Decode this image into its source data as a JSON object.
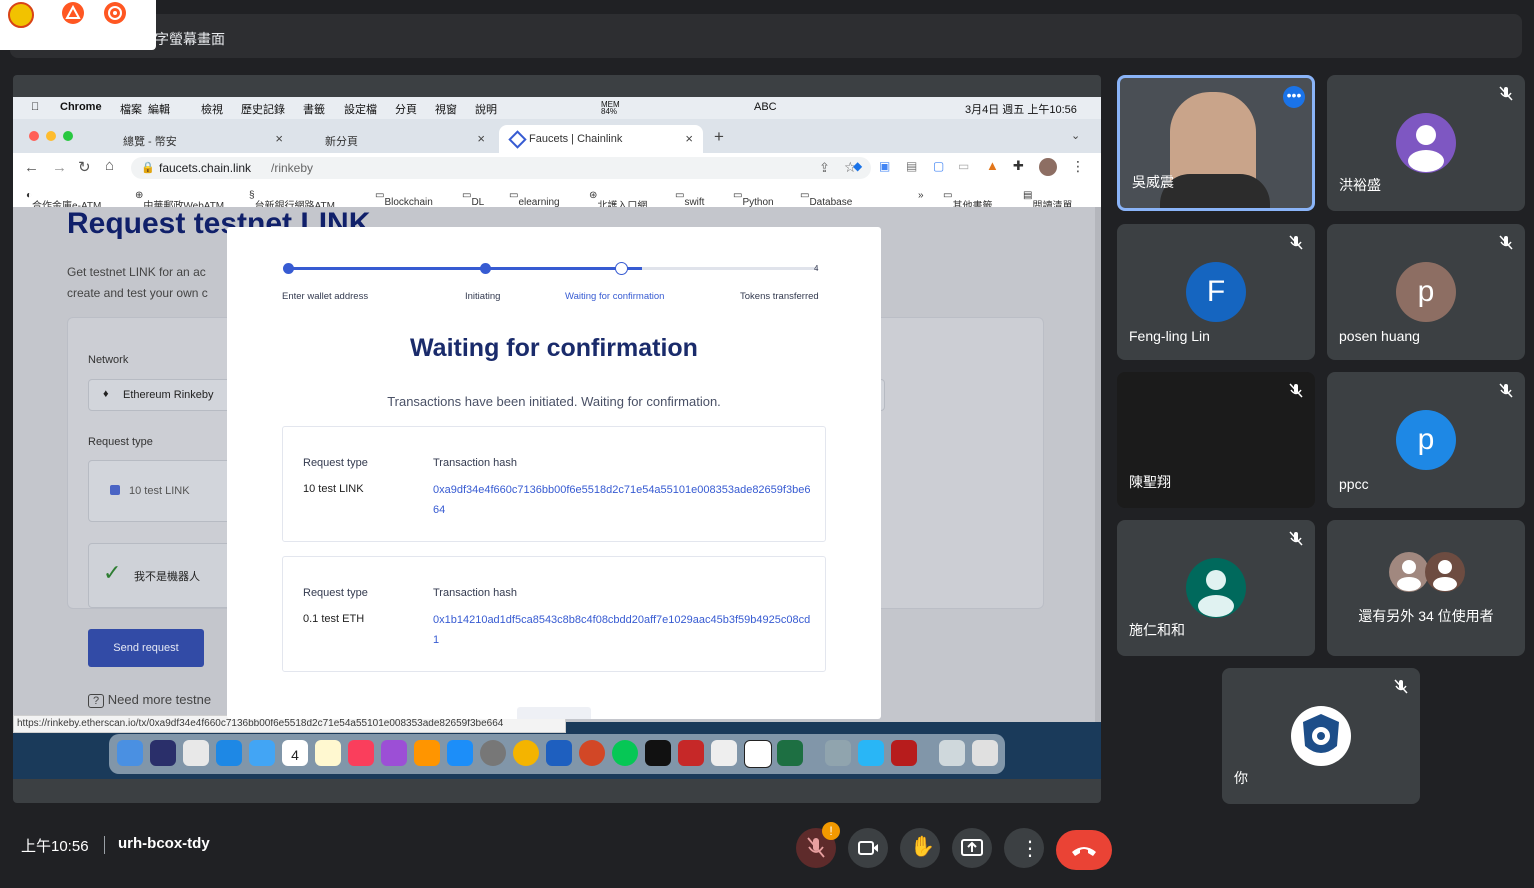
{
  "banner": {
    "title": "字螢幕畫面"
  },
  "mac_menu": {
    "apple": "",
    "app": "Chrome",
    "items": [
      "檔案",
      "編輯",
      "檢視",
      "歷史記錄",
      "書籤",
      "設定檔",
      "分頁",
      "視窗",
      "說明"
    ],
    "mem": "MEM 84%",
    "input": "ABC",
    "datetime": "3月4日 週五 上午10:56"
  },
  "tabs": [
    {
      "label": "總覽 - 幣安"
    },
    {
      "label": "新分頁"
    },
    {
      "label": "Faucets | Chainlink"
    }
  ],
  "omnibox": {
    "host": "faucets.chain.link",
    "path": "/rinkeby"
  },
  "bookmarks": [
    "合作金庫e-ATM",
    "中華郵政WebATM",
    "台新銀行網路ATM...",
    "Blockchain",
    "DL",
    "elearning",
    "北護入口網",
    "swift",
    "Python",
    "Database",
    "»",
    "其他書籤",
    "閱讀清單"
  ],
  "page": {
    "title": "Request testnet LINK",
    "intro_1": "Get testnet LINK for an ac",
    "intro_2": "create and test your own c",
    "network_label": "Network",
    "network_value": "Ethereum Rinkeby",
    "request_type_label": "Request type",
    "request_option": "10 test LINK",
    "captcha_label": "我不是機器人",
    "send_button": "Send request",
    "need_more": "Need more testne"
  },
  "modal": {
    "steps": [
      {
        "label": "Enter wallet address",
        "state": "done"
      },
      {
        "label": "Initiating",
        "state": "done"
      },
      {
        "label": "Waiting for confirmation",
        "state": "current"
      },
      {
        "label": "Tokens transferred",
        "state": "pending",
        "number": "4"
      }
    ],
    "progress_fraction": 0.667,
    "title": "Waiting for confirmation",
    "subtitle": "Transactions have been initiated. Waiting for confirmation.",
    "transactions": [
      {
        "type_label": "Request type",
        "type_value": "10 test LINK",
        "hash_label": "Transaction hash",
        "hash": "0xa9df34e4f660c7136bb00f6e5518d2c71e54a55101e008353ade82659f3be664"
      },
      {
        "type_label": "Request type",
        "type_value": "0.1 test ETH",
        "hash_label": "Transaction hash",
        "hash": "0x1b14210ad1df5ca8543c8b8c4f08cbdd20aff7e1029aac45b3f59b4925c08cd1"
      }
    ]
  },
  "status_url": "https://rinkeby.etherscan.io/tx/0xa9df34e4f660c7136bb00f6e5518d2c71e54a55101e008353ade82659f3be664",
  "dock_calendar_day": "4",
  "participants": [
    {
      "name": "吳威震",
      "type": "video",
      "muted": false
    },
    {
      "name": "洪裕盛",
      "type": "avatar",
      "initial": "",
      "color": "#7e57c2",
      "muted": true
    },
    {
      "name": "Feng-ling Lin",
      "type": "avatar",
      "initial": "F",
      "color": "#1565c0",
      "muted": true
    },
    {
      "name": "posen huang",
      "type": "avatar",
      "initial": "p",
      "color": "#8d6e63",
      "muted": true
    },
    {
      "name": "陳聖翔",
      "type": "blank",
      "muted": true
    },
    {
      "name": "ppcc",
      "type": "avatar",
      "initial": "p",
      "color": "#1e88e5",
      "muted": true
    },
    {
      "name": "施仁和和",
      "type": "avatar",
      "initial": "",
      "color": "#00695c",
      "muted": true
    },
    {
      "name": "還有另外 34 位使用者",
      "type": "others",
      "muted": false
    },
    {
      "name": "你",
      "type": "logo",
      "muted": true
    }
  ],
  "bottom": {
    "time": "上午10:56",
    "meeting_code": "urh-bcox-tdy",
    "mic_warning": "!"
  },
  "colors": {
    "accent_red": "#ea4335",
    "chainlink_blue": "#375bd2",
    "meet_bg": "#202124",
    "tile_bg": "#3c4043"
  }
}
